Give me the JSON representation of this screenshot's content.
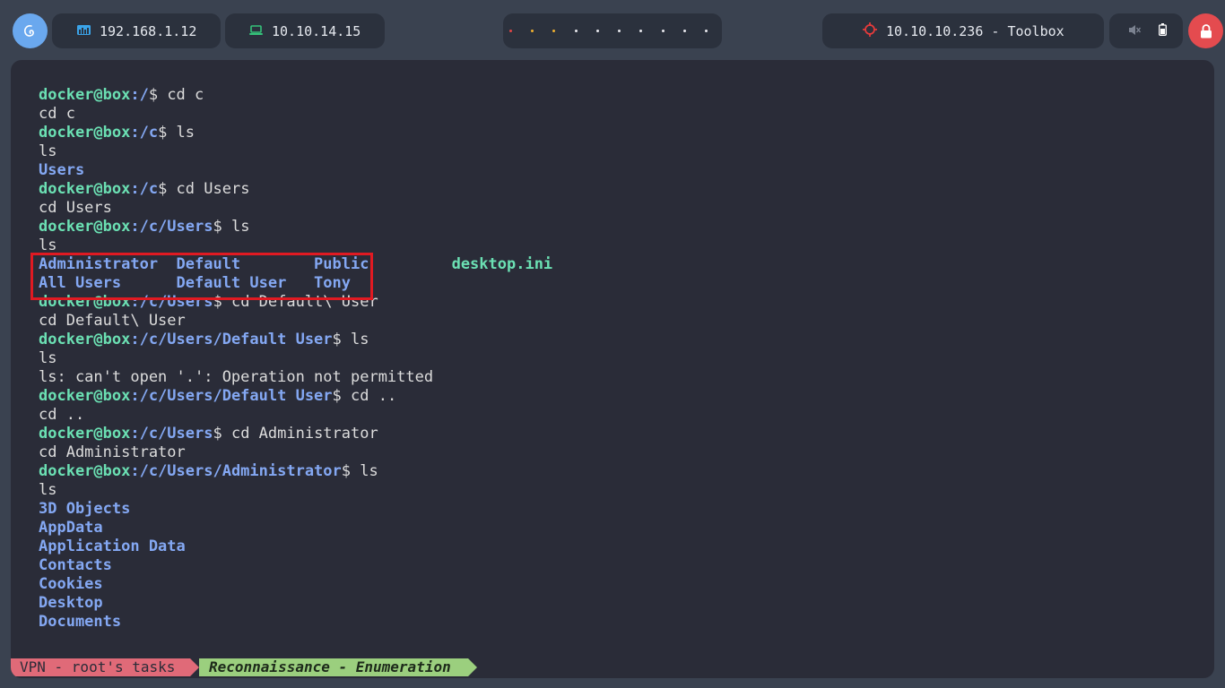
{
  "topbar": {
    "ip_local": "192.168.1.12",
    "ip_vpn": "10.10.14.15",
    "target": "10.10.10.236 - Toolbox",
    "workspace_dot_colors": [
      "#e04646",
      "#f0b030",
      "#f0b030",
      "#e8e8ee",
      "#e8e8ee",
      "#e8e8ee",
      "#e8e8ee",
      "#e8e8ee",
      "#e8e8ee",
      "#e8e8ee"
    ],
    "icons": {
      "logo": "debian-swirl-icon",
      "local": "network-icon",
      "vpn": "laptop-icon",
      "target": "crosshair-icon",
      "sound": "muted-speaker-icon",
      "battery": "battery-icon",
      "lock": "lock-icon"
    },
    "colors": {
      "network_icon": "#3aa3e8",
      "laptop_icon": "#35c27a",
      "target_icon": "#e83b3b"
    }
  },
  "terminal": {
    "lines": [
      [
        {
          "c": "u",
          "t": "docker@box"
        },
        {
          "c": "p",
          "t": ":/"
        },
        {
          "c": "n",
          "t": "$ cd c"
        }
      ],
      [
        {
          "c": "n",
          "t": "cd c"
        }
      ],
      [
        {
          "c": "u",
          "t": "docker@box"
        },
        {
          "c": "p",
          "t": ":/c"
        },
        {
          "c": "n",
          "t": "$ ls"
        }
      ],
      [
        {
          "c": "n",
          "t": "ls"
        }
      ],
      [
        {
          "c": "d",
          "t": "Users"
        }
      ],
      [
        {
          "c": "u",
          "t": "docker@box"
        },
        {
          "c": "p",
          "t": ":/c"
        },
        {
          "c": "n",
          "t": "$ cd Users"
        }
      ],
      [
        {
          "c": "n",
          "t": "cd Users"
        }
      ],
      [
        {
          "c": "u",
          "t": "docker@box"
        },
        {
          "c": "p",
          "t": ":/c/Users"
        },
        {
          "c": "n",
          "t": "$ ls"
        }
      ],
      [
        {
          "c": "n",
          "t": "ls"
        }
      ],
      [
        {
          "c": "d",
          "t": "Administrator  Default        Public         "
        },
        {
          "c": "f",
          "t": "desktop.ini"
        }
      ],
      [
        {
          "c": "d",
          "t": "All Users      Default User   Tony"
        }
      ],
      [
        {
          "c": "u",
          "t": "docker@box"
        },
        {
          "c": "p",
          "t": ":/c/Users"
        },
        {
          "c": "n",
          "t": "$ cd Default\\ User"
        }
      ],
      [
        {
          "c": "n",
          "t": "cd Default\\ User"
        }
      ],
      [
        {
          "c": "u",
          "t": "docker@box"
        },
        {
          "c": "p",
          "t": ":/c/Users/Default User"
        },
        {
          "c": "n",
          "t": "$ ls"
        }
      ],
      [
        {
          "c": "n",
          "t": "ls"
        }
      ],
      [
        {
          "c": "n",
          "t": "ls: can't open '.': Operation not permitted"
        }
      ],
      [
        {
          "c": "u",
          "t": "docker@box"
        },
        {
          "c": "p",
          "t": ":/c/Users/Default User"
        },
        {
          "c": "n",
          "t": "$ cd .."
        }
      ],
      [
        {
          "c": "n",
          "t": "cd .."
        }
      ],
      [
        {
          "c": "u",
          "t": "docker@box"
        },
        {
          "c": "p",
          "t": ":/c/Users"
        },
        {
          "c": "n",
          "t": "$ cd Administrator"
        }
      ],
      [
        {
          "c": "n",
          "t": "cd Administrator"
        }
      ],
      [
        {
          "c": "u",
          "t": "docker@box"
        },
        {
          "c": "p",
          "t": ":/c/Users/Administrator"
        },
        {
          "c": "n",
          "t": "$ ls"
        }
      ],
      [
        {
          "c": "n",
          "t": "ls"
        }
      ],
      [
        {
          "c": "d",
          "t": "3D Objects"
        }
      ],
      [
        {
          "c": "d",
          "t": "AppData"
        }
      ],
      [
        {
          "c": "d",
          "t": "Application Data"
        }
      ],
      [
        {
          "c": "d",
          "t": "Contacts"
        }
      ],
      [
        {
          "c": "d",
          "t": "Cookies"
        }
      ],
      [
        {
          "c": "d",
          "t": "Desktop"
        }
      ],
      [
        {
          "c": "d",
          "t": "Documents"
        }
      ]
    ]
  },
  "statusline": {
    "session": "VPN - root's tasks",
    "window": "Reconnaissance - Enumeration"
  },
  "colors": {
    "terminal_bg": "#2a2c38",
    "user_host": "#6be0b3",
    "path": "#84a8f3",
    "highlight_box": "#e01a22",
    "status_session": "#e06a78",
    "status_window": "#9bcf7e"
  }
}
